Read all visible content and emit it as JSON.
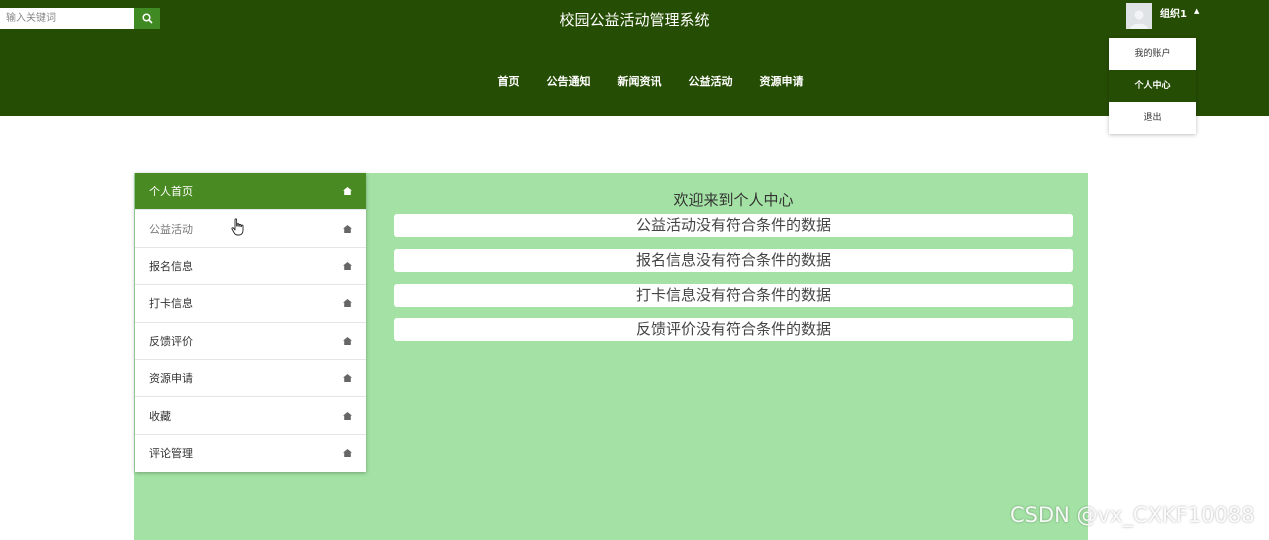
{
  "search": {
    "placeholder": "输入关键词",
    "icon": "search-icon"
  },
  "site_title": "校园公益活动管理系统",
  "nav": [
    "首页",
    "公告通知",
    "新闻资讯",
    "公益活动",
    "资源申请"
  ],
  "user": {
    "name": "组织1",
    "menu": [
      "我的账户",
      "个人中心",
      "退出"
    ],
    "active_menu": "个人中心"
  },
  "sidebar": {
    "items": [
      {
        "label": "个人首页",
        "icon": "home-icon"
      },
      {
        "label": "公益活动",
        "icon": "home-icon"
      },
      {
        "label": "报名信息",
        "icon": "home-icon"
      },
      {
        "label": "打卡信息",
        "icon": "home-icon"
      },
      {
        "label": "反馈评价",
        "icon": "home-icon"
      },
      {
        "label": "资源申请",
        "icon": "home-icon"
      },
      {
        "label": "收藏",
        "icon": "home-icon"
      },
      {
        "label": "评论管理",
        "icon": "home-icon"
      }
    ],
    "active": "个人首页",
    "hovered": "公益活动"
  },
  "main": {
    "welcome": "欢迎来到个人中心",
    "empty_messages": [
      "公益活动没有符合条件的数据",
      "报名信息没有符合条件的数据",
      "打卡信息没有符合条件的数据",
      "反馈评价没有符合条件的数据"
    ]
  },
  "watermark": "CSDN @vx_CXKF10088",
  "colors": {
    "header": "#264d04",
    "active": "#4a8a22",
    "content_bg": "#a3e2a4"
  }
}
